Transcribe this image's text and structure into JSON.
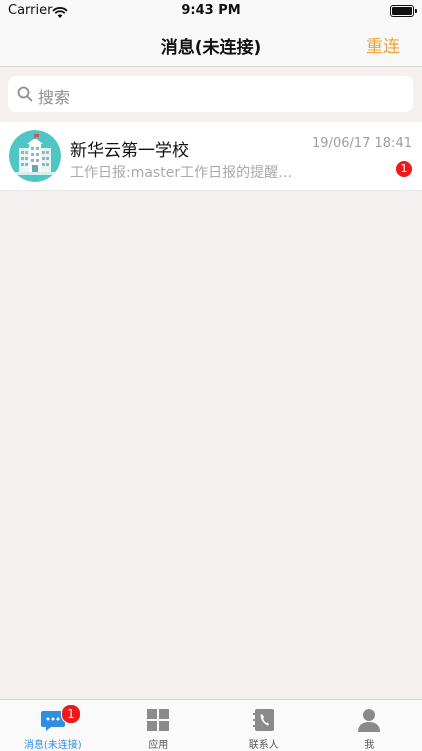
{
  "status_bar": {
    "carrier": "Carrier",
    "time": "9:43 PM"
  },
  "nav": {
    "title": "消息(未连接)",
    "action": "重连"
  },
  "search": {
    "placeholder": "搜索"
  },
  "chats": [
    {
      "name": "新华云第一学校",
      "time": "19/06/17 18:41",
      "preview": "工作日报:master工作日报的提醒…",
      "unread": "1",
      "avatar_icon": "school-building-icon"
    }
  ],
  "tabs": [
    {
      "label": "消息(未连接)",
      "icon": "chat-bubble-icon",
      "badge": "1",
      "active": true
    },
    {
      "label": "应用",
      "icon": "grid-apps-icon"
    },
    {
      "label": "联系人",
      "icon": "contacts-book-icon"
    },
    {
      "label": "我",
      "icon": "person-icon"
    }
  ],
  "colors": {
    "accent_orange": "#f0a33a",
    "active_tab_blue": "#2f8de4",
    "badge_red": "#ec1a1a",
    "background": "#f3f0ef"
  }
}
